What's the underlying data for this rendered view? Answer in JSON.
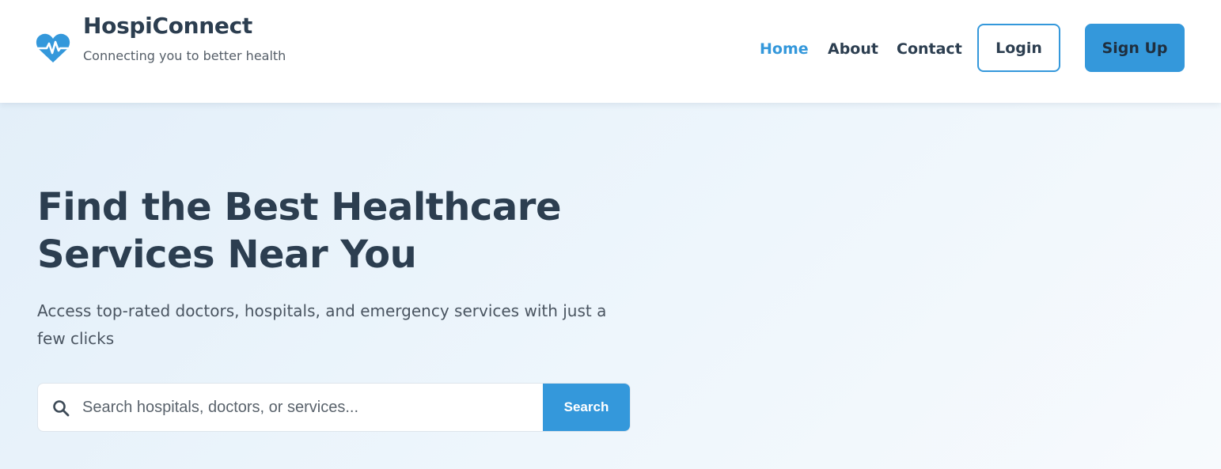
{
  "brand": {
    "name": "HospiConnect",
    "tagline": "Connecting you to better health",
    "logo_icon": "heartbeat-icon",
    "accent_color": "#3498db"
  },
  "nav": {
    "items": [
      {
        "label": "Home",
        "active": true
      },
      {
        "label": "About",
        "active": false
      },
      {
        "label": "Contact",
        "active": false
      }
    ],
    "login_label": "Login",
    "signup_label": "Sign Up"
  },
  "hero": {
    "title": "Find the Best Healthcare Services Near You",
    "subtitle": "Access top-rated doctors, hospitals, and emergency services with just a few clicks"
  },
  "search": {
    "icon": "search-icon",
    "placeholder": "Search hospitals, doctors, or services...",
    "value": "",
    "button_label": "Search"
  }
}
